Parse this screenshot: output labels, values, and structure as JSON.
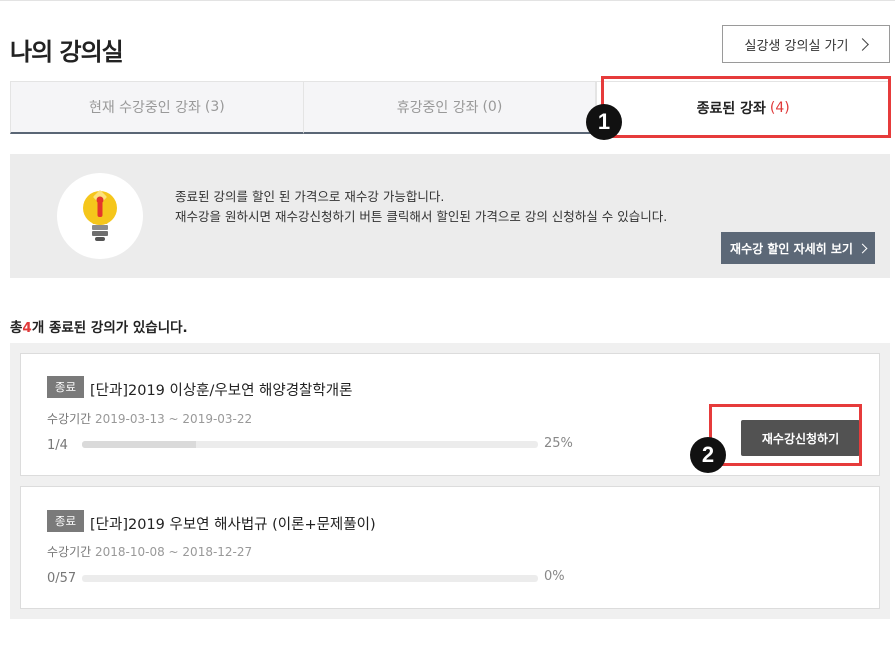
{
  "header": {
    "title": "나의 강의실",
    "live_button_label": "실강생 강의실 가기"
  },
  "tabs": [
    {
      "label": "현재 수강중인 강좌",
      "count": "(3)",
      "active": false
    },
    {
      "label": "휴강중인 강좌",
      "count": "(0)",
      "active": false
    },
    {
      "label": "종료된 강좌",
      "count": "(4)",
      "active": true
    }
  ],
  "annotations": {
    "marker_1": "1",
    "marker_2": "2",
    "highlight_color": "#e63b3b"
  },
  "info": {
    "line1": "종료된 강의를 할인 된 가격으로 재수강 가능합니다.",
    "line2": "재수강을 원하시면 재수강신청하기 버튼 클릭해서 할인된 가격으로 강의 신청하실 수 있습니다.",
    "button_label": "재수강 할인 자세히 보기",
    "bulb_icon": "lightbulb-icon"
  },
  "summary": {
    "prefix": "총",
    "count": "4",
    "suffix": "개 종료된 강의가 있습니다."
  },
  "courses": [
    {
      "status": "종료",
      "title": "[단과]2019 이상훈/우보연 해양경찰학개론",
      "period_label": "수강기간",
      "period": "2019-03-13 ~ 2019-03-22",
      "progress_label": "1/4",
      "percent": "25%",
      "progress": 0.25,
      "retake_label": "재수강신청하기"
    },
    {
      "status": "종료",
      "title": "[단과]2019 우보연 해사법규 (이론+문제풀이)",
      "period_label": "수강기간",
      "period": "2018-10-08 ~ 2018-12-27",
      "progress_label": "0/57",
      "percent": "0%",
      "progress": 0
    }
  ],
  "colors": {
    "accent_red": "#e03a3a",
    "tab_underline": "#5a6675",
    "retake_button": "#525252"
  }
}
